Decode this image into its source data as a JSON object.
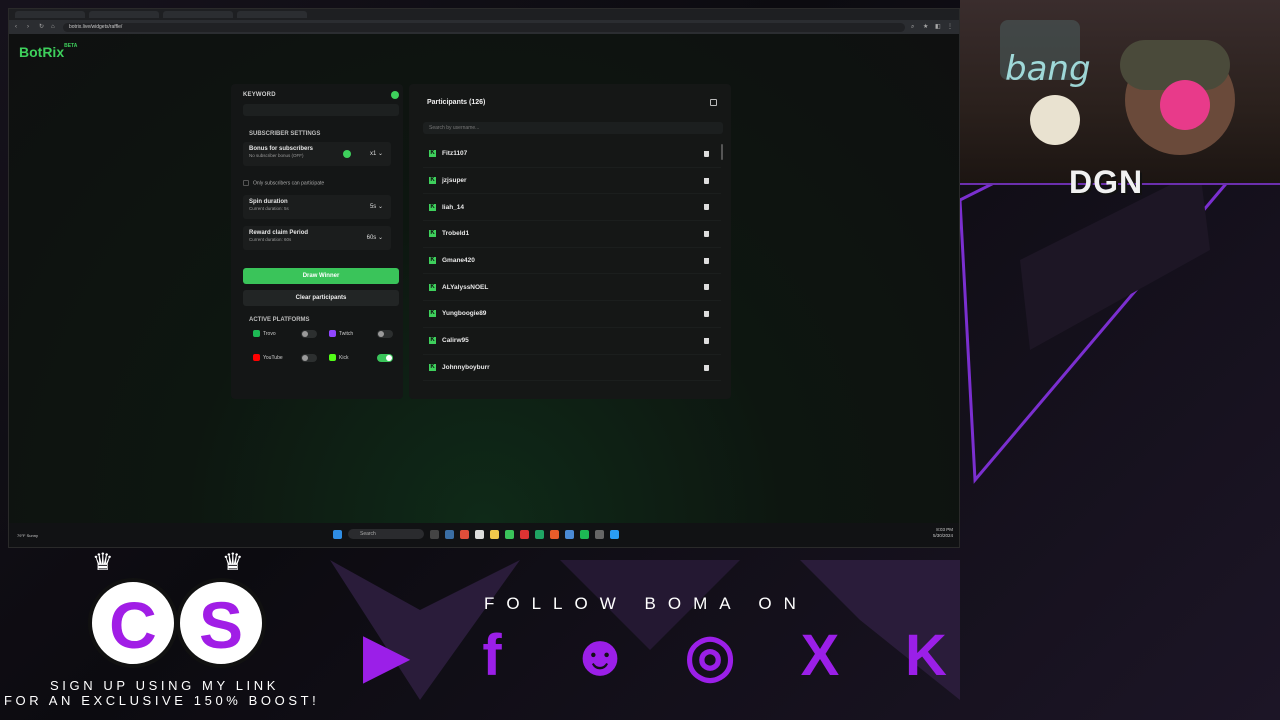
{
  "browser": {
    "url": "botrix.live/widgets/raffle/",
    "brand": "BotRix",
    "brand_badge": "BETA"
  },
  "raffle": {
    "keyword_label": "KEYWORD",
    "subscriber_settings_label": "SUBSCRIBER SETTINGS",
    "bonus_title": "Bonus for subscribers",
    "bonus_sub": "No subscriber bonus (OFF)",
    "bonus_value": "x1",
    "only_subs_label": "Only subscribers can participate",
    "spin_title": "Spin duration",
    "spin_sub": "Current duration: 5s",
    "spin_value": "5s",
    "reward_title": "Reward claim Period",
    "reward_sub": "Current duration: 60s",
    "reward_value": "60s",
    "draw_button": "Draw Winner",
    "clear_button": "Clear participants",
    "active_platforms_label": "ACTIVE PLATFORMS",
    "platforms": [
      {
        "name": "Trovo",
        "enabled": false,
        "color": "#1db954"
      },
      {
        "name": "Twitch",
        "enabled": false,
        "color": "#9146ff"
      },
      {
        "name": "YouTube",
        "enabled": false,
        "color": "#ff0000"
      },
      {
        "name": "Kick",
        "enabled": true,
        "color": "#53fc18"
      }
    ]
  },
  "participants": {
    "title": "Participants (126)",
    "search_placeholder": "Search by username...",
    "list": [
      "Fitz1107",
      "jzjsuper",
      "liah_14",
      "Trobeld1",
      "Gmane420",
      "ALYalyssNOEL",
      "Yungboogie89",
      "Calirw95",
      "Johnnyboyburr"
    ]
  },
  "taskbar": {
    "search_label": "Search",
    "weather": "79°F Sunny",
    "time": "8:03 PM",
    "date": "5/30/2024"
  },
  "overlay": {
    "webcam_text": "DGN",
    "follow_text": "FOLLOW BOMA ON",
    "signup_line1": "SIGN UP USING MY LINK",
    "signup_line2": "FOR AN EXCLUSIVE 150% BOOST!",
    "logo_letters": [
      "C",
      "S"
    ],
    "socials": [
      "youtube-icon",
      "facebook-icon",
      "discord-icon",
      "instagram-icon",
      "x-icon",
      "kick-icon"
    ],
    "accent": "#9b1fe8"
  }
}
